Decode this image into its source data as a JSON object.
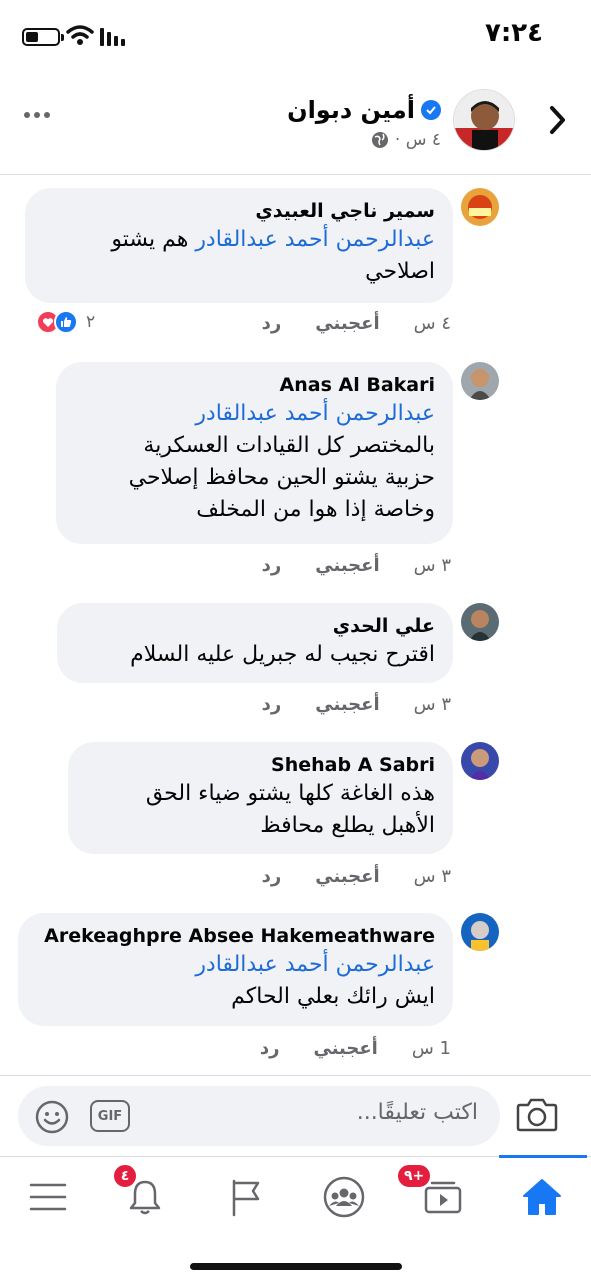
{
  "status_bar": {
    "time": "٧:٢٤"
  },
  "header": {
    "name": "أمين دبوان",
    "meta": "٤ س ·",
    "icons": [
      "chevron-right-icon",
      "verified-icon",
      "globe-icon",
      "more-icon"
    ]
  },
  "comments": [
    {
      "author": "سمير ناجي العبيدي",
      "mention": "عبدالرحمن أحمد عبدالقادر",
      "mention_suffix": " هم يشتو",
      "lines": [
        "اصلاحي"
      ],
      "time": "٤ س",
      "like_label": "أعجبني",
      "reply_label": "رد",
      "reactions_count": "٢"
    },
    {
      "author": "Anas Al Bakari",
      "mention": "عبدالرحمن أحمد عبدالقادر",
      "lines": [
        "بالمختصر كل القيادات العسكرية",
        "حزبية يشتو الحين محافظ إصلاحي",
        "وخاصة إذا هوا من المخلف"
      ],
      "time": "٣ س",
      "like_label": "أعجبني",
      "reply_label": "رد"
    },
    {
      "author": "علي الحدي",
      "lines": [
        "اقترح نجيب له جبريل عليه السلام"
      ],
      "time": "٣ س",
      "like_label": "أعجبني",
      "reply_label": "رد"
    },
    {
      "author": "Shehab A Sabri",
      "lines": [
        "هذه الغاغة كلها يشتو ضياء الحق",
        "الأهبل يطلع محافظ"
      ],
      "time": "٣ س",
      "like_label": "أعجبني",
      "reply_label": "رد"
    },
    {
      "author": "Arekeaghpre Absee Hakemeathware",
      "mention": "عبدالرحمن أحمد عبدالقادر",
      "lines": [
        "ايش رائك بعلي الحاكم"
      ],
      "time": "1 س",
      "like_label": "أعجبني",
      "reply_label": "رد"
    }
  ],
  "composer": {
    "placeholder": "اكتب تعليقًا...",
    "gif_label": "GIF",
    "icons": [
      "emoji-icon",
      "camera-icon"
    ]
  },
  "bottom_nav": {
    "notifications_badge": "٤",
    "watch_badge": "٩+",
    "icons": [
      "menu-icon",
      "bell-icon",
      "flag-icon",
      "groups-icon",
      "watch-icon",
      "home-icon"
    ]
  },
  "colors": {
    "accent": "#1877f2",
    "mention": "#1f6bd6",
    "bubble": "#f0f2f5",
    "badge": "#e41e3f",
    "secondary_text": "#65676b"
  }
}
